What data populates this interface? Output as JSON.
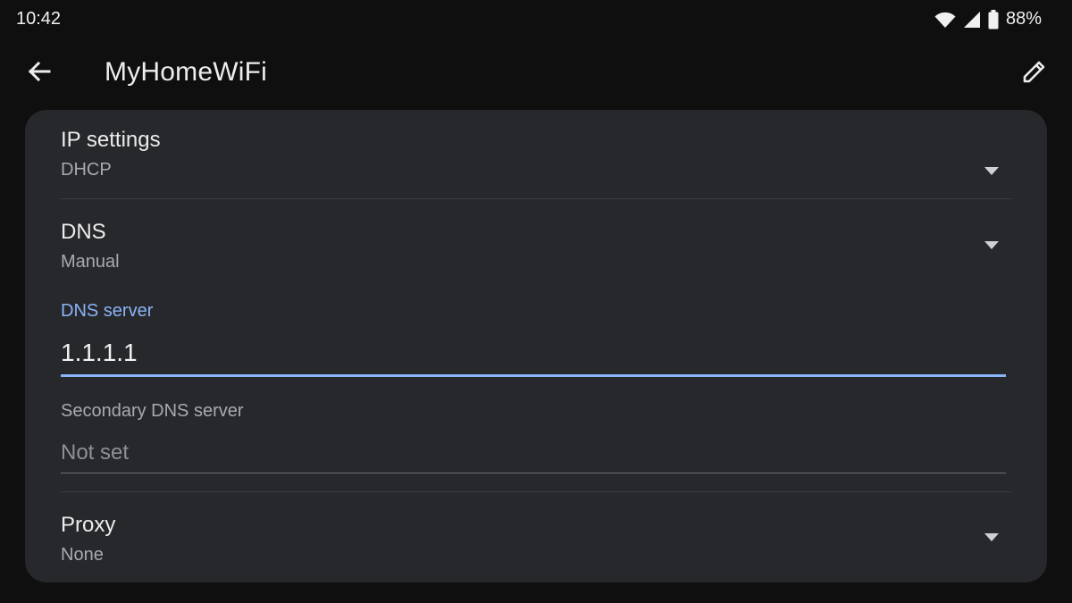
{
  "status_bar": {
    "time": "10:42",
    "battery": "88%",
    "icons": [
      "wifi-icon",
      "cellular-signal-icon",
      "battery-icon"
    ]
  },
  "app_bar": {
    "title": "MyHomeWiFi",
    "icons": [
      "back-arrow-icon",
      "edit-pencil-icon"
    ]
  },
  "settings": {
    "ip_settings": {
      "title": "IP settings",
      "value": "DHCP"
    },
    "dns": {
      "title": "DNS",
      "value": "Manual"
    },
    "dns_server": {
      "label": "DNS server",
      "value": "1.1.1.1"
    },
    "secondary_dns": {
      "label": "Secondary DNS server",
      "placeholder": "Not set"
    },
    "proxy": {
      "title": "Proxy",
      "value": "None"
    }
  },
  "colors": {
    "background": "#0f0f10",
    "card": "#27282b",
    "accent": "#8ab4f8",
    "text_primary": "#ececee",
    "text_secondary": "#a9aaae"
  }
}
